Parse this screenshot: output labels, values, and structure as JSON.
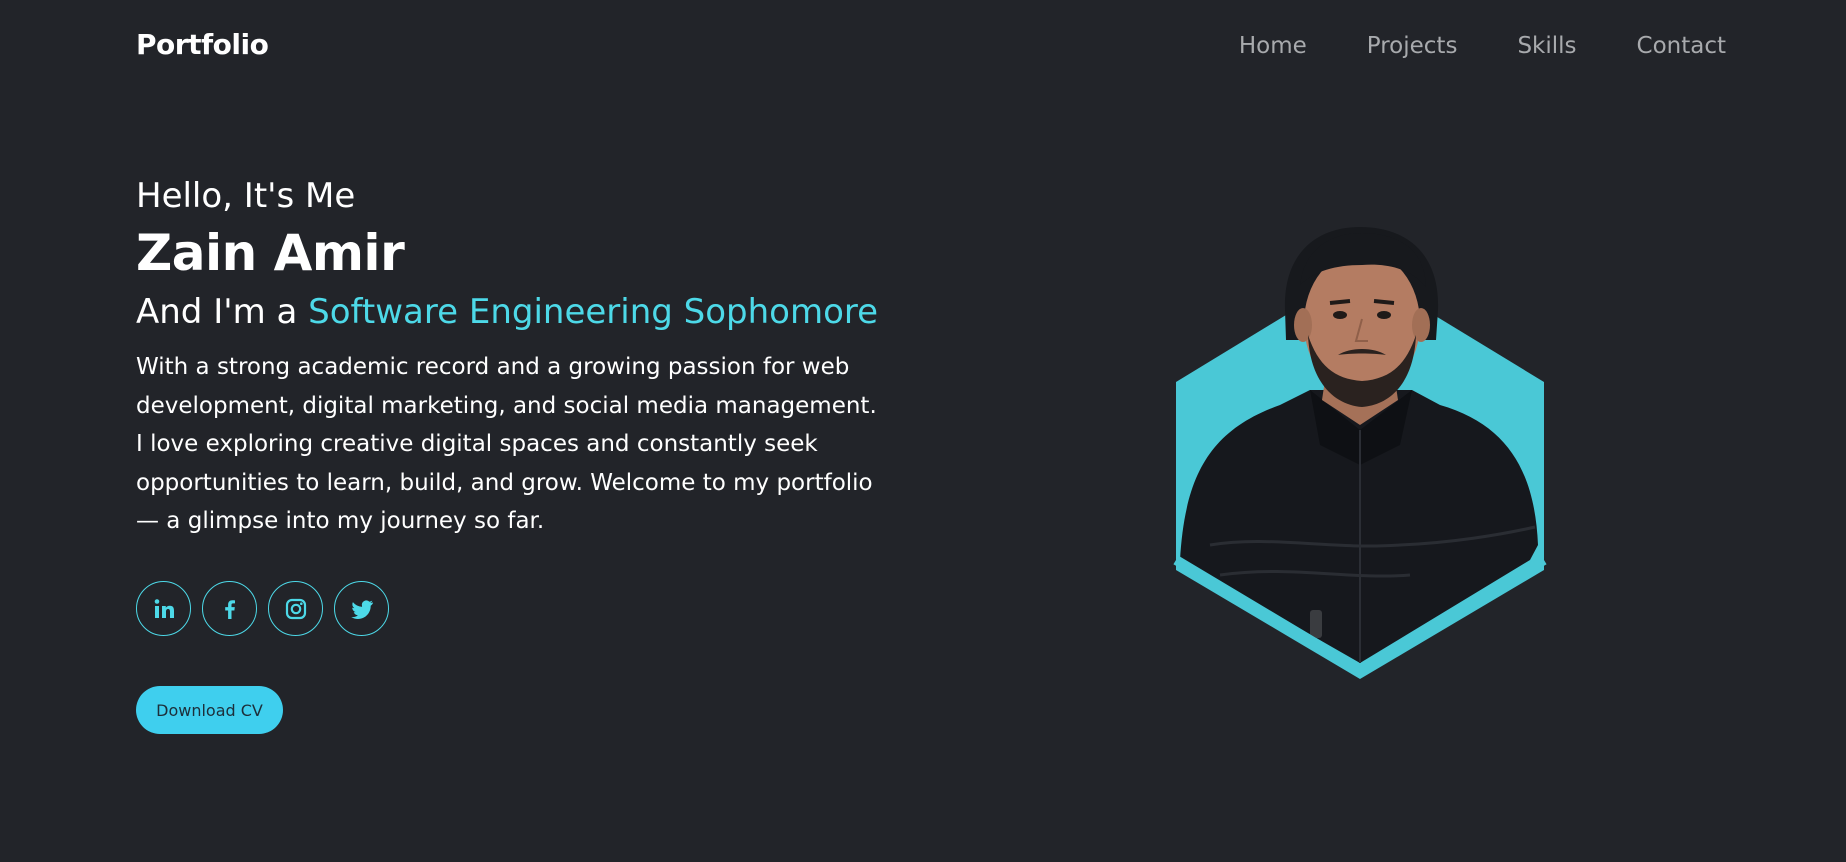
{
  "header": {
    "brand": "Portfolio",
    "nav": [
      "Home",
      "Projects",
      "Skills",
      "Contact"
    ]
  },
  "hero": {
    "greeting": "Hello, It's Me",
    "name": "Zain Amir",
    "role_prefix": "And I'm a ",
    "role": "Software Engineering Sophomore",
    "bio": "With a strong academic record and a growing passion for web development, digital marketing, and social media management. I love exploring creative digital spaces and constantly seek opportunities to learn, build, and grow. Welcome to my portfolio — a glimpse into my journey so far.",
    "cta": "Download CV"
  },
  "social": [
    {
      "icon": "linkedin-icon"
    },
    {
      "icon": "facebook-icon"
    },
    {
      "icon": "instagram-icon"
    },
    {
      "icon": "twitter-icon"
    }
  ],
  "colors": {
    "background": "#222429",
    "accent": "#4dd9e8",
    "button": "#3fcfee",
    "nav": "#a8aaad"
  }
}
